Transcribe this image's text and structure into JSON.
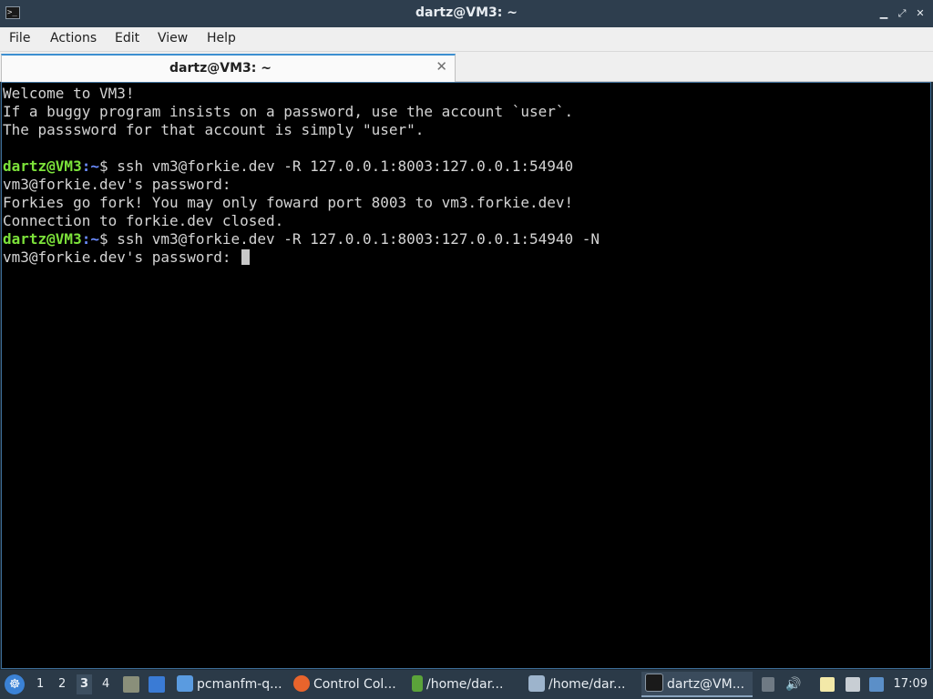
{
  "window": {
    "title": "dartz@VM3: ~",
    "app_icon": "terminal-icon",
    "minimize_glyph": "▁",
    "maximize_glyph": "⤢",
    "close_glyph": "✕"
  },
  "menu": {
    "items": [
      "File",
      "Actions",
      "Edit",
      "View",
      "Help"
    ]
  },
  "tab": {
    "label": "dartz@VM3: ~",
    "close_glyph": "✕"
  },
  "terminal": {
    "lines": [
      "Welcome to VM3!",
      "If a buggy program insists on a password, use the account `user`.",
      "The passsword for that account is simply \"user\".",
      ""
    ],
    "prompt_user": "dartz@VM3",
    "prompt_path": ":~",
    "prompt_symbol": "$ ",
    "cmd1": "ssh vm3@forkie.dev -R 127.0.0.1:8003:127.0.0.1:54940",
    "out1": "vm3@forkie.dev's password:",
    "out2": "Forkies go fork! You may only foward port 8003 to vm3.forkie.dev!",
    "out3": "Connection to forkie.dev closed.",
    "cmd2": "ssh vm3@forkie.dev -R 127.0.0.1:8003:127.0.0.1:54940 -N",
    "out4": "vm3@forkie.dev's password: "
  },
  "taskbar": {
    "workspaces": [
      "1",
      "2",
      "3",
      "4"
    ],
    "active_workspace": "3",
    "tasks": [
      {
        "label": "pcmanfm-q...",
        "icon": "folder-icon"
      },
      {
        "label": "Control Col...",
        "icon": "firefox-icon"
      },
      {
        "label": "/home/dar...",
        "icon": "text-editor-icon"
      },
      {
        "label": "/home/dar...",
        "icon": "feather-icon"
      },
      {
        "label": "dartz@VM...",
        "icon": "terminal-icon"
      }
    ],
    "clock": "17:09"
  },
  "colors": {
    "titlebar": "#2e3e4e",
    "terminal_bg": "#000000",
    "prompt_user": "#7ce23a",
    "prompt_path": "#6b8cff",
    "taskbar": "#2b3a48"
  }
}
